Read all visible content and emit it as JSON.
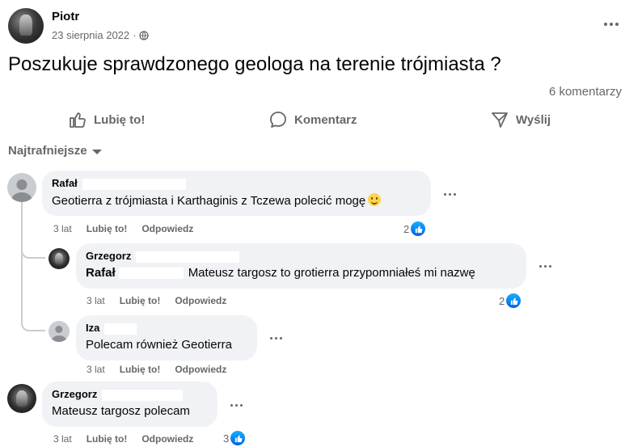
{
  "post": {
    "author": "Piotr",
    "date": "23 sierpnia 2022",
    "separator": "·",
    "text": "Poszukuje sprawdzonego geologa na terenie trójmiasta ?",
    "comments_count": "6 komentarzy"
  },
  "actions": {
    "like": "Lubię to!",
    "comment": "Komentarz",
    "share": "Wyślij"
  },
  "sort": {
    "label": "Najtrafniejsze"
  },
  "comments": [
    {
      "name": "Rafał",
      "text": "Geotierra z trójmiasta i Karthaginis z Tczewa polecić mogę",
      "time": "3 lat",
      "like": "Lubię to!",
      "reply": "Odpowiedz",
      "reactions": "2"
    },
    {
      "name": "Grzegorz",
      "mention": "Rafał",
      "text": "Mateusz targosz to grotierra przypomniałeś mi nazwę",
      "time": "3 lat",
      "like": "Lubię to!",
      "reply": "Odpowiedz",
      "reactions": "2"
    },
    {
      "name": "Iza",
      "text": "Polecam również Geotierra",
      "time": "3 lat",
      "like": "Lubię to!",
      "reply": "Odpowiedz"
    },
    {
      "name": "Grzegorz",
      "text": "Mateusz targosz polecam",
      "time": "3 lat",
      "like": "Lubię to!",
      "reply": "Odpowiedz",
      "reactions": "3"
    }
  ],
  "icons": {
    "privacy": "globe-icon",
    "like": "thumbs-up-icon",
    "comment": "speech-bubble-icon",
    "share": "send-icon",
    "reaction": "like-reaction-icon"
  },
  "colors": {
    "secondary_text": "#65676b",
    "bubble_bg": "#f0f2f5",
    "like_blue": "#0866ff"
  }
}
